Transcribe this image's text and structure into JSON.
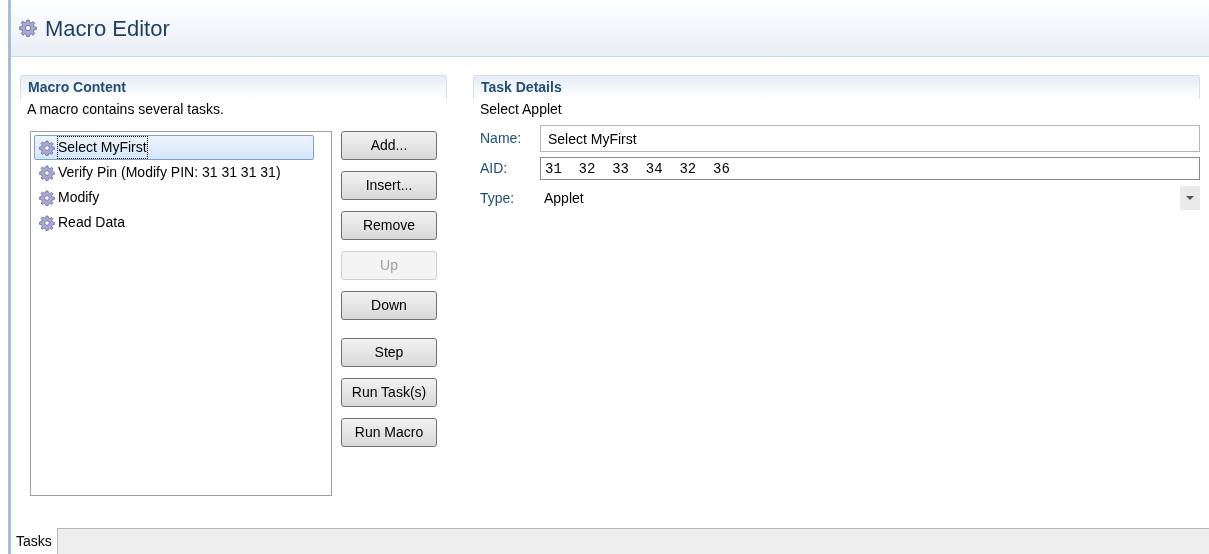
{
  "editor": {
    "title": "Macro Editor"
  },
  "macro_content": {
    "title": "Macro Content",
    "description": "A macro contains several tasks.",
    "tasks": [
      {
        "label": "Select MyFirst",
        "selected": true
      },
      {
        "label": "Verify Pin (Modify PIN: 31 31 31 31)",
        "selected": false
      },
      {
        "label": "Modify",
        "selected": false
      },
      {
        "label": "Read Data",
        "selected": false
      }
    ],
    "button_groups": [
      [
        {
          "label": "Add...",
          "disabled": false
        },
        {
          "label": "Insert...",
          "disabled": false
        },
        {
          "label": "Remove",
          "disabled": false
        },
        {
          "label": "Up",
          "disabled": true
        },
        {
          "label": "Down",
          "disabled": false
        }
      ],
      [
        {
          "label": "Step",
          "disabled": false
        },
        {
          "label": "Run Task(s)",
          "disabled": false
        },
        {
          "label": "Run Macro",
          "disabled": false
        }
      ]
    ]
  },
  "task_details": {
    "title": "Task Details",
    "subtitle": "Select Applet",
    "name": {
      "label": "Name:",
      "value": "Select MyFirst"
    },
    "aid": {
      "label": "AID:",
      "value": "31  32  33  34  32  36"
    },
    "type": {
      "label": "Type:",
      "value": "Applet"
    }
  },
  "tabs": [
    {
      "label": "Tasks",
      "selected": true
    }
  ]
}
